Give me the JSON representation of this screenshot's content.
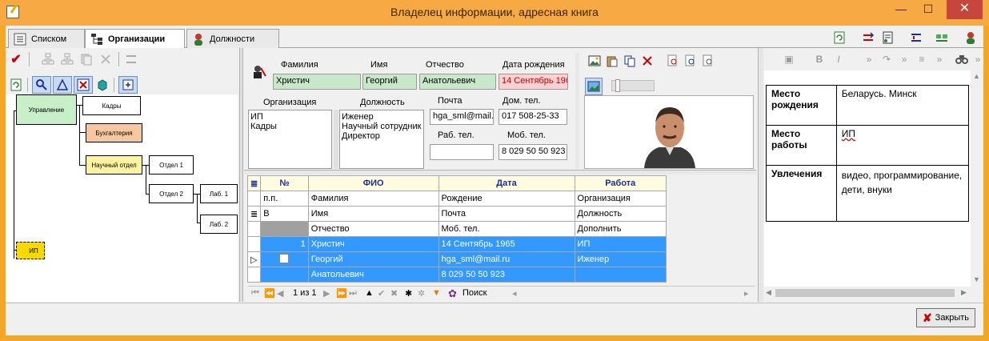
{
  "window": {
    "title": "Владелец информации, адресная книга",
    "minimize": "—",
    "maximize": "☐",
    "close": "✕"
  },
  "tabs": [
    {
      "label": "Списком"
    },
    {
      "label": "Организации"
    },
    {
      "label": "Должности"
    }
  ],
  "org_tree": {
    "nodes": [
      "Управление",
      "Кадры",
      "Бухгалтерия",
      "Научный отдел",
      "Отдел 1",
      "Отдел 2",
      "Лаб. 1",
      "Лаб. 2",
      "ИП"
    ]
  },
  "form": {
    "labels": {
      "surname": "Фамилия",
      "name": "Имя",
      "patronymic": "Отчество",
      "birthdate": "Дата рождения",
      "organization": "Организация",
      "position": "Должность",
      "mail": "Почта",
      "home_phone": "Дом. тел.",
      "work_phone": "Раб. тел.",
      "mobile": "Моб. тел."
    },
    "values": {
      "surname": "Христич",
      "name": "Георгий",
      "patronymic": "Анатольевич",
      "birthdate": "14 Сентябрь 19б",
      "mail": "hga_sml@mail.r",
      "home_phone": "017 508-25-33",
      "work_phone": "",
      "mobile": "8 029 50 50 923"
    },
    "organizations": [
      "ИП",
      "Кадры"
    ],
    "positions": [
      "Иженер",
      "Научный сотрудник",
      "Директор"
    ]
  },
  "grid": {
    "headers": [
      "№",
      "ФИО",
      "Дата",
      "Работа"
    ],
    "subheaders": [
      [
        "п.п.",
        "Фамилия",
        "Рождение",
        "Организация"
      ],
      [
        "В",
        "Имя",
        "Почта",
        "Должность"
      ],
      [
        "",
        "Отчество",
        "Моб. тел.",
        "Дополнить"
      ]
    ],
    "rows": [
      [
        "1",
        "Христич",
        "14 Сентябрь 1965",
        "ИП"
      ],
      [
        "",
        "Георгий",
        "hga_sml@mail.ru",
        "Иженер"
      ],
      [
        "",
        "Анатольевич",
        "8 029 50 50 923",
        ""
      ]
    ]
  },
  "navigator": {
    "position": "1 из 1",
    "search_label": "Поиск"
  },
  "info_table": [
    {
      "key": "Место рождения",
      "value": "Беларусь. Минск"
    },
    {
      "key": "Место работы",
      "value": "ИП"
    },
    {
      "key": "Увлечения",
      "value": "видео, программирование, дети, внуки"
    }
  ],
  "footer": {
    "close_button": "Закрыть"
  },
  "colors": {
    "accent": "#f7a944",
    "selection": "#3399ff",
    "header_text": "#1a2f9a"
  }
}
